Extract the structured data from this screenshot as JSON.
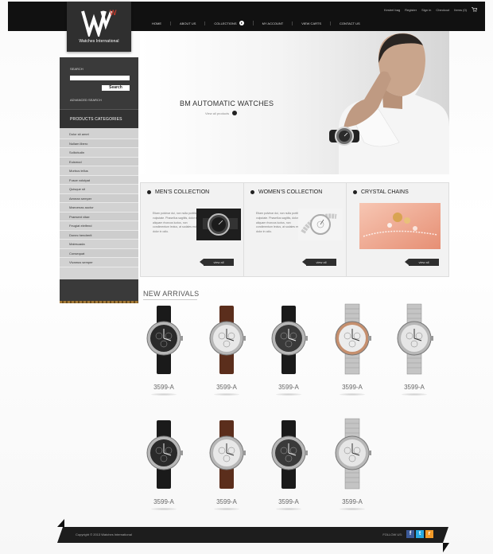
{
  "top_links": [
    "Kestrel bag",
    "Register",
    "Sign in",
    "Checkout",
    "Items (0)"
  ],
  "nav": [
    {
      "label": "HOME"
    },
    {
      "label": "ABOUT US"
    },
    {
      "label": "COLLECTIONS"
    },
    {
      "label": "MY ACCOUNT"
    },
    {
      "label": "VIEW CARTS"
    },
    {
      "label": "CONTACT US"
    }
  ],
  "logo": {
    "text": "Watches International",
    "letters": "W",
    "accent": "#c0392b"
  },
  "sidebar": {
    "search_label": "SEARCH",
    "search_placeholder": "",
    "search_button": "Search",
    "advanced_search": "ADVANCED SEARCH",
    "categories_title": "PRODUCTS CATEGORIES",
    "categories": [
      "Dolor sit amet",
      "Nullam libero",
      "Sollicitudin",
      "Euismod",
      "Morbus tellus",
      "Fusce volutpat",
      "Quisque sit",
      "Aenean semper",
      "Maecenas auctor",
      "Praesent vitae",
      "Feugiat eleifend",
      "Donec hendrerit",
      "Malesuada",
      "Consequat",
      "Vivamus semper"
    ]
  },
  "hero": {
    "title": "BM AUTOMATIC WATCHES",
    "subtitle": "View all products"
  },
  "collections": [
    {
      "title": "MEN'S COLLECTION",
      "text": "Etiam pulvinar dui, non nulla porttitor, vulputate. Phasellus sagittis, dolor et aliquam rhoncus luctus, non condimentum lectus, at sodales est dolor in odio.",
      "view_all": "view all"
    },
    {
      "title": "WOMEN'S COLLECTION",
      "text": "Etiam pulvinar dui, non nulla porttitor, vulputate. Phasellus sagittis, dolor et aliquam rhoncus luctus, non condimentum lectus, at sodales est dolor in odio.",
      "view_all": "view all"
    },
    {
      "title": "CRYSTAL CHAINS",
      "text": "",
      "view_all": "view all"
    }
  ],
  "new_arrivals": {
    "title": "NEW ARRIVALS",
    "products": [
      {
        "price": "3599-A",
        "dial": "#2a2a2a",
        "strap": "#1a1a1a"
      },
      {
        "price": "3599-A",
        "dial": "#e8e8e8",
        "strap": "#5b2e1c"
      },
      {
        "price": "3599-A",
        "dial": "#3a3a3a",
        "strap": "#1a1a1a"
      },
      {
        "price": "3599-A",
        "dial": "#ececec",
        "strap": "metal-rose"
      },
      {
        "price": "3599-A",
        "dial": "#e6e6e6",
        "strap": "metal"
      },
      {
        "price": "3599-A",
        "dial": "#2a2a2a",
        "strap": "#1a1a1a"
      },
      {
        "price": "3599-A",
        "dial": "#e8e8e8",
        "strap": "#5b2e1c"
      },
      {
        "price": "3599-A",
        "dial": "#3a3a3a",
        "strap": "#1a1a1a"
      },
      {
        "price": "3599-A",
        "dial": "#e6e6e6",
        "strap": "metal"
      }
    ]
  },
  "footer": {
    "copyright": "Copyright © 2013 Watches International",
    "follow_label": "FOLLOW US:",
    "social": [
      {
        "name": "facebook-icon",
        "glyph": "f",
        "color": "#3b5998"
      },
      {
        "name": "twitter-icon",
        "glyph": "t",
        "color": "#29a9e1"
      },
      {
        "name": "rss-icon",
        "glyph": "r",
        "color": "#f39a28"
      }
    ]
  }
}
